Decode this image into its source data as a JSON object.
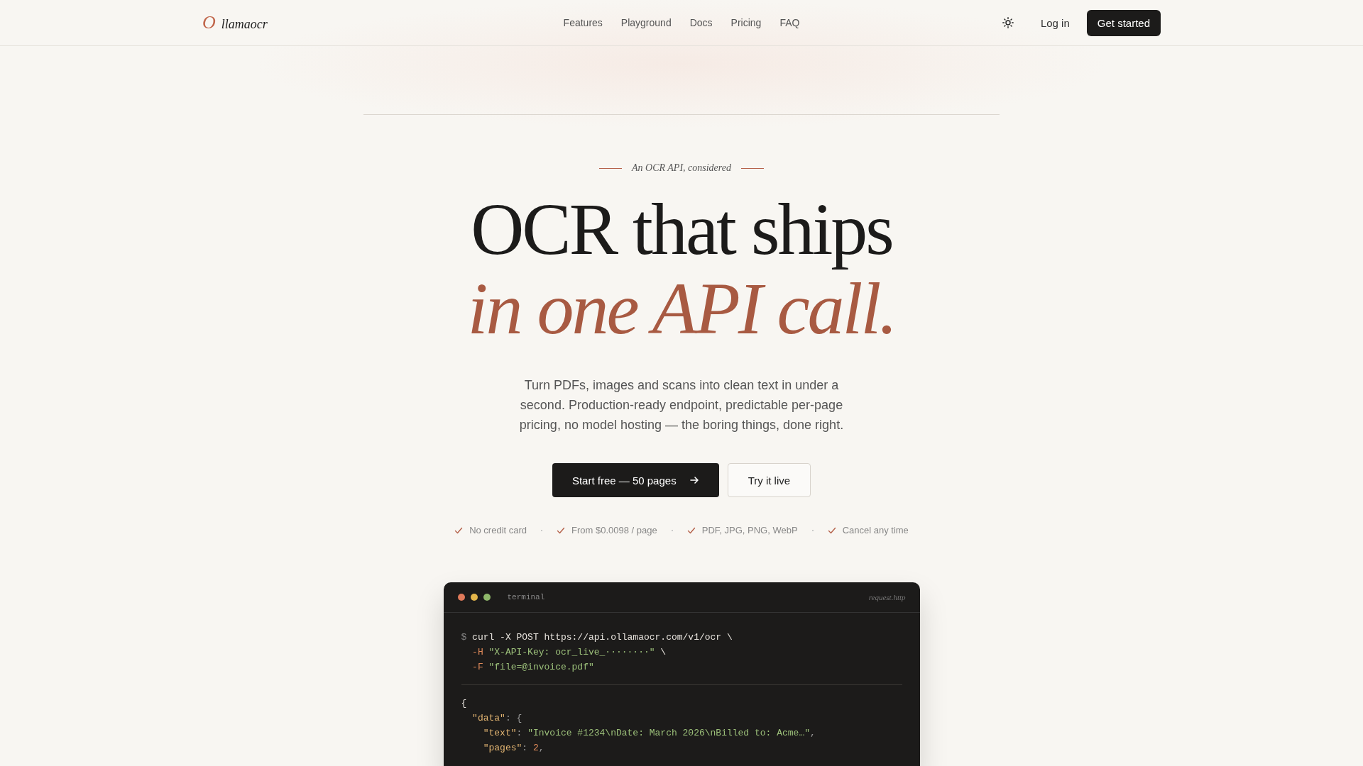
{
  "header": {
    "logo_mark": "O",
    "logo_text": "llamaocr",
    "nav": [
      {
        "label": "Features"
      },
      {
        "label": "Playground"
      },
      {
        "label": "Docs"
      },
      {
        "label": "Pricing"
      },
      {
        "label": "FAQ"
      }
    ],
    "login": "Log in",
    "cta": "Get started"
  },
  "hero": {
    "eyebrow": "An OCR API, considered",
    "headline": [
      {
        "kind": "plain",
        "text": "OCR that ships"
      },
      {
        "kind": "accent",
        "text": "in one API call."
      }
    ],
    "lead": "Turn PDFs, images and scans into clean text in under a second. Production-ready endpoint, predictable per-page pricing, no model hosting — the boring things, done right.",
    "primary_button": "Start free — 50 pages",
    "secondary_button": "Try it live",
    "checks": [
      {
        "label": "No credit card"
      },
      {
        "label": "From $0.0098 / page"
      },
      {
        "label": "PDF, JPG, PNG, WebP"
      },
      {
        "label": "Cancel any time"
      }
    ]
  },
  "terminal": {
    "title": "terminal",
    "file": "request.http",
    "command_lines": [
      [
        {
          "kind": "prompt",
          "text": "$ "
        },
        {
          "kind": "plain",
          "text": "curl -X POST https://api.ollamaocr.com/v1/ocr \\"
        }
      ],
      [
        {
          "kind": "flag",
          "text": "  -H "
        },
        {
          "kind": "string",
          "text": "\"X-API-Key: ocr_live_········\""
        },
        {
          "kind": "plain",
          "text": " \\"
        }
      ],
      [
        {
          "kind": "flag",
          "text": "  -F "
        },
        {
          "kind": "string",
          "text": "\"file=@invoice.pdf\""
        }
      ]
    ],
    "response_lines": [
      [
        {
          "kind": "plain",
          "text": "{"
        }
      ],
      [
        {
          "kind": "key",
          "text": "  \"data\""
        },
        {
          "kind": "punct",
          "text": ": {"
        }
      ],
      [
        {
          "kind": "key",
          "text": "    \"text\""
        },
        {
          "kind": "punct",
          "text": ": "
        },
        {
          "kind": "string",
          "text": "\"Invoice #1234\\nDate: March 2026\\nBilled to: Acme…\""
        },
        {
          "kind": "punct",
          "text": ","
        }
      ],
      [
        {
          "kind": "key",
          "text": "    \"pages\""
        },
        {
          "kind": "punct",
          "text": ": "
        },
        {
          "kind": "number",
          "text": "2"
        },
        {
          "kind": "punct",
          "text": ","
        }
      ]
    ]
  }
}
